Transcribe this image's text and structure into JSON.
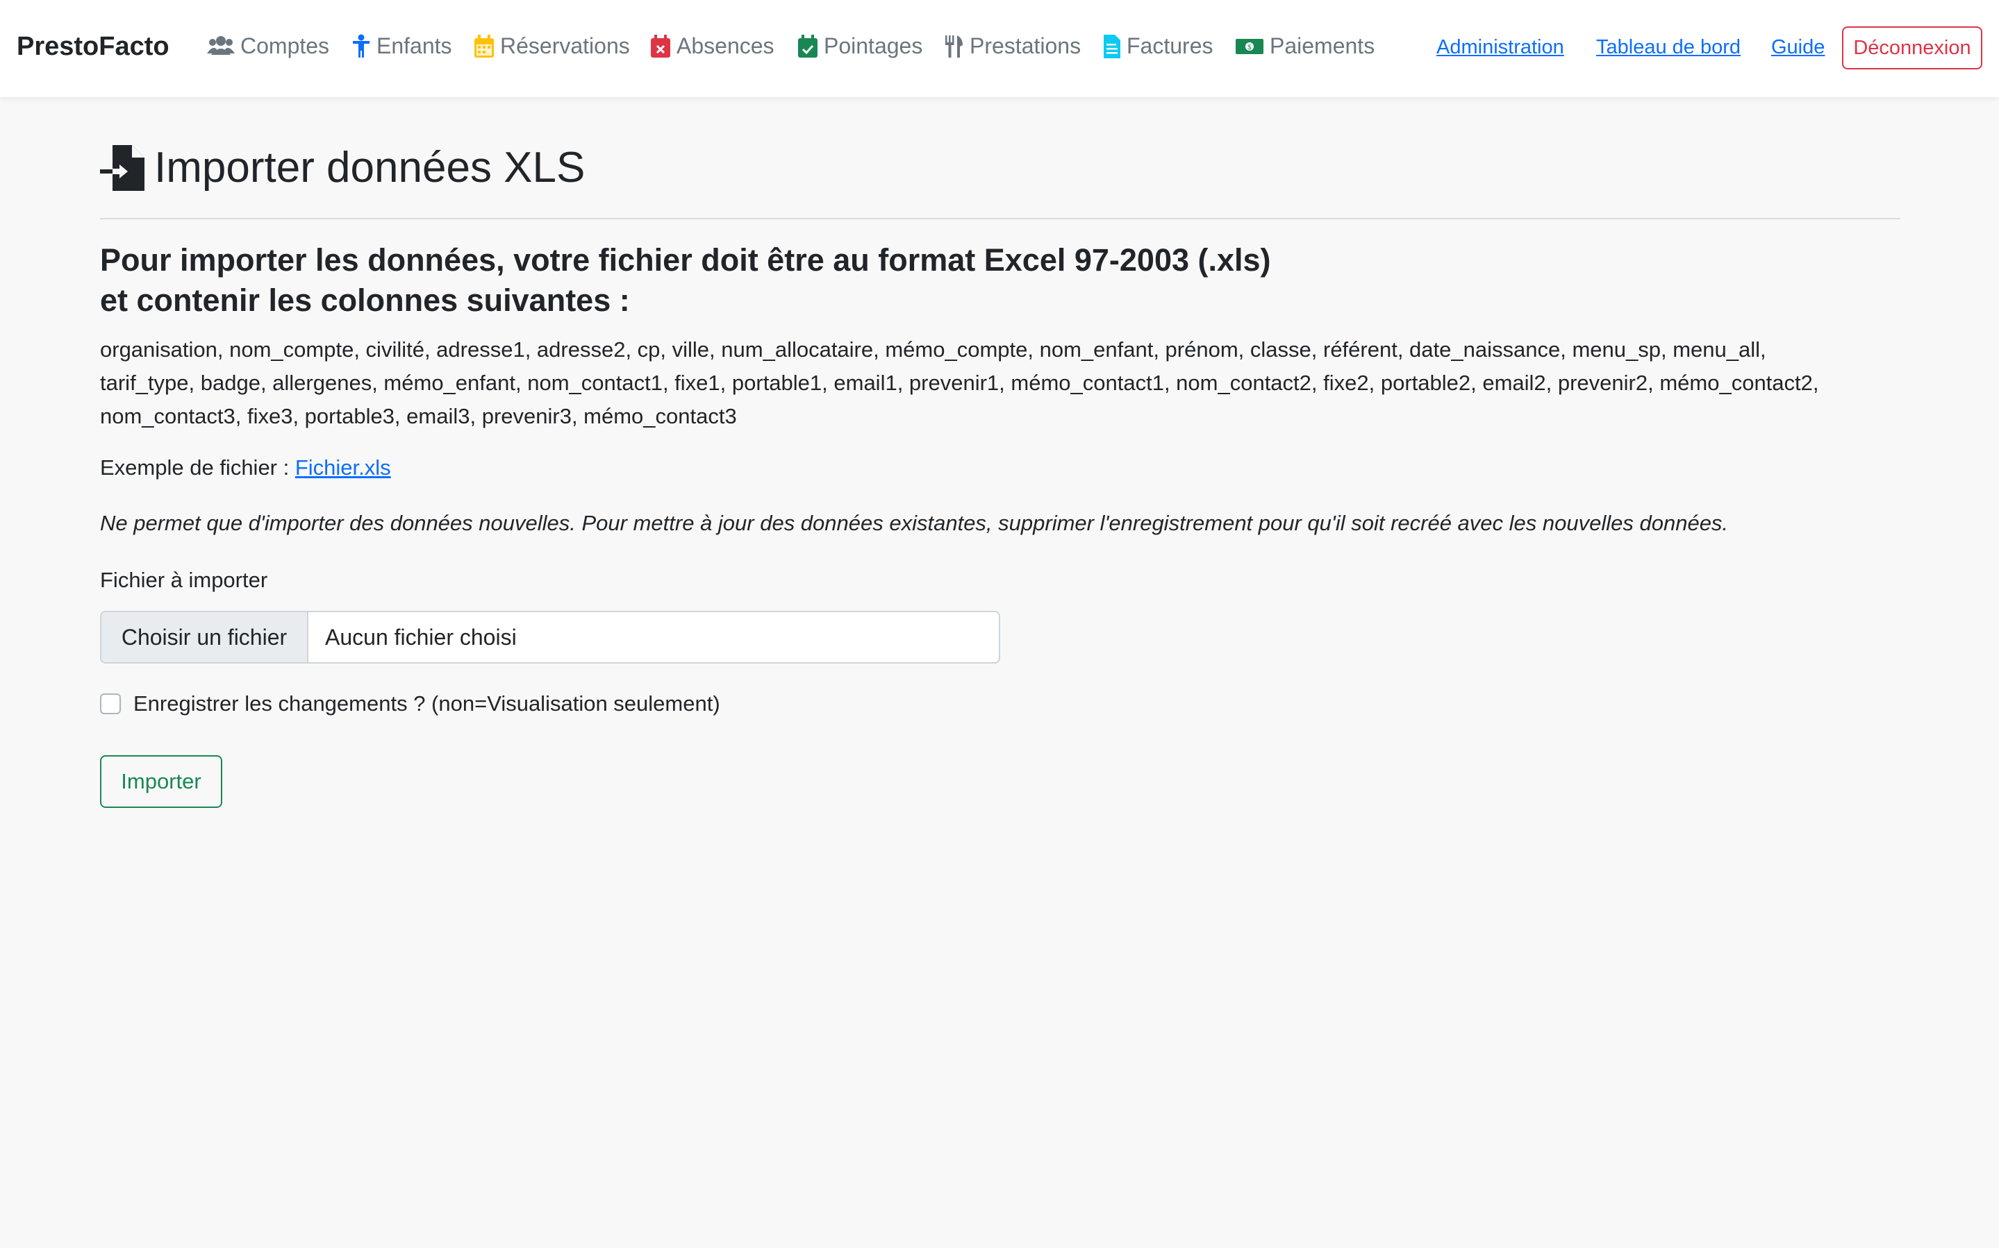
{
  "nav": {
    "brand": "PrestoFacto",
    "items": [
      {
        "label": "Comptes",
        "icon": "users-icon",
        "color": "#6c757d"
      },
      {
        "label": "Enfants",
        "icon": "child-icon",
        "color": "#0d6efd"
      },
      {
        "label": "Réservations",
        "icon": "calendar-icon",
        "color": "#ffc107"
      },
      {
        "label": "Absences",
        "icon": "calendar-x-icon",
        "color": "#dc3545"
      },
      {
        "label": "Pointages",
        "icon": "calendar-check-icon",
        "color": "#198754"
      },
      {
        "label": "Prestations",
        "icon": "utensils-icon",
        "color": "#6c757d"
      },
      {
        "label": "Factures",
        "icon": "invoice-icon",
        "color": "#0dcaf0"
      },
      {
        "label": "Paiements",
        "icon": "money-icon",
        "color": "#198754"
      }
    ],
    "links": {
      "admin": "Administration",
      "dashboard": "Tableau de bord",
      "guide": "Guide",
      "logout": "Déconnexion"
    }
  },
  "page": {
    "title": "Importer données XLS",
    "lead_line1": "Pour importer les données, votre fichier doit être au format Excel 97-2003 (.xls)",
    "lead_line2": "et contenir les colonnes suivantes :",
    "columns_line1": "organisation, nom_compte, civilité, adresse1, adresse2, cp, ville, num_allocataire, mémo_compte, nom_enfant, prénom, classe, référent, date_naissance, menu_sp, menu_all,",
    "columns_line2": "tarif_type, badge, allergenes, mémo_enfant, nom_contact1, fixe1, portable1, email1, prevenir1, mémo_contact1, nom_contact2, fixe2, portable2, email2, prevenir2, mémo_contact2,",
    "columns_line3": "nom_contact3, fixe3, portable3, email3, prevenir3, mémo_contact3",
    "example_label": "Exemple de fichier :",
    "example_link": "Fichier.xls",
    "note": "Ne permet que d'importer des données nouvelles. Pour mettre à jour des données existantes, supprimer l'enregistrement pour qu'il soit recréé avec les nouvelles données.",
    "file_label": "Fichier à importer",
    "file_button": "Choisir un fichier",
    "file_status": "Aucun fichier choisi",
    "checkbox_label": "Enregistrer les changements ? (non=Visualisation seulement)",
    "submit": "Importer"
  }
}
